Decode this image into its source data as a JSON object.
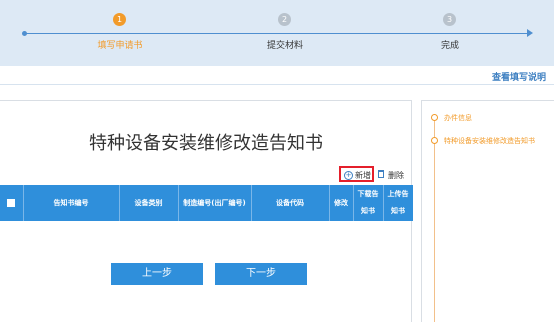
{
  "steps": [
    {
      "num": "1",
      "label": "填写申请书",
      "state": "active"
    },
    {
      "num": "2",
      "label": "提交材料",
      "state": "pending"
    },
    {
      "num": "3",
      "label": "完成",
      "state": "pending"
    }
  ],
  "help_link": "查看填写说明",
  "document": {
    "title": "特种设备安装维修改造告知书"
  },
  "toolbar": {
    "add_label": "新增",
    "delete_label": "删除",
    "add_icon": "plus-circle-icon",
    "delete_icon": "trash-icon"
  },
  "table": {
    "columns": [
      {
        "label": "告知书编号"
      },
      {
        "label": "设备类别"
      },
      {
        "label": "制造编号(出厂编号)"
      },
      {
        "label": "设备代码"
      },
      {
        "label": "修改"
      },
      {
        "label_line1": "下载告",
        "label_line2": "知书"
      },
      {
        "label_line1": "上传告",
        "label_line2": "知书"
      }
    ],
    "rows": []
  },
  "nav_buttons": {
    "prev": "上一步",
    "next": "下一步"
  },
  "sidebar": {
    "items": [
      {
        "label": "办件信息"
      },
      {
        "label": "特种设备安装维修改造告知书"
      }
    ]
  },
  "colors": {
    "accent_orange": "#f29b2a",
    "primary_blue": "#2f8fdb",
    "highlight_red": "#e41f2b"
  }
}
